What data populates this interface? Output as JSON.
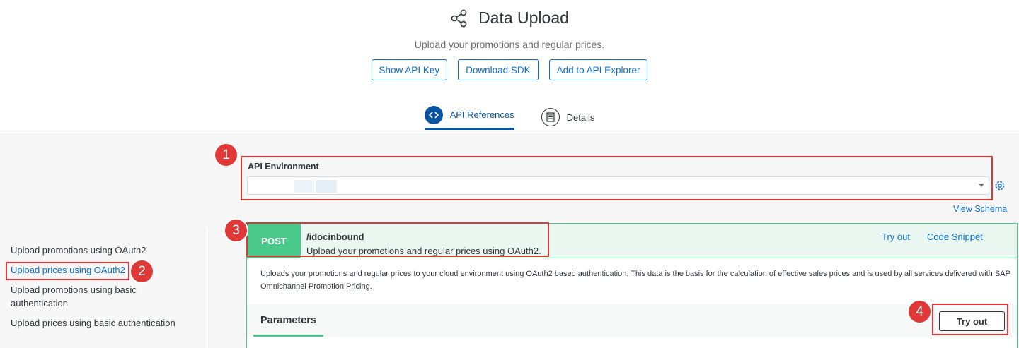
{
  "header": {
    "title": "Data Upload",
    "subtitle": "Upload your promotions and regular prices.",
    "buttons": [
      "Show API Key",
      "Download SDK",
      "Add to API Explorer"
    ],
    "title_icon": "share-icon"
  },
  "tabs": [
    {
      "label": "API References",
      "icon": "code-icon",
      "active": true
    },
    {
      "label": "Details",
      "icon": "document-icon",
      "active": false
    }
  ],
  "environment": {
    "label": "API Environment",
    "value": "",
    "settings_icon": "gear-icon"
  },
  "view_schema": "View Schema",
  "sidebar": {
    "items": [
      {
        "label": "Upload promotions using OAuth2",
        "active": false
      },
      {
        "label": "Upload prices using OAuth2",
        "active": true
      },
      {
        "label": "Upload promotions using basic authentication",
        "active": false
      },
      {
        "label": "Upload prices using basic authentication",
        "active": false
      }
    ]
  },
  "operation": {
    "method": "POST",
    "path": "/idocinbound",
    "summary": "Upload your promotions and regular prices using OAuth2.",
    "actions": [
      "Try out",
      "Code Snippet"
    ],
    "description": "Uploads your promotions and regular prices to your cloud environment using OAuth2 based authentication. This data is the basis for the calculation of effective sales prices and is used by all services delivered with SAP Omnichannel Promotion Pricing.",
    "parameters_title": "Parameters",
    "try_out_button": "Try out"
  },
  "annotations": [
    "1",
    "2",
    "3",
    "4"
  ],
  "colors": {
    "accent": "#0a6ed1",
    "tab_active": "#0854a0",
    "post_green": "#49c98a",
    "highlight_red": "#e03737"
  }
}
